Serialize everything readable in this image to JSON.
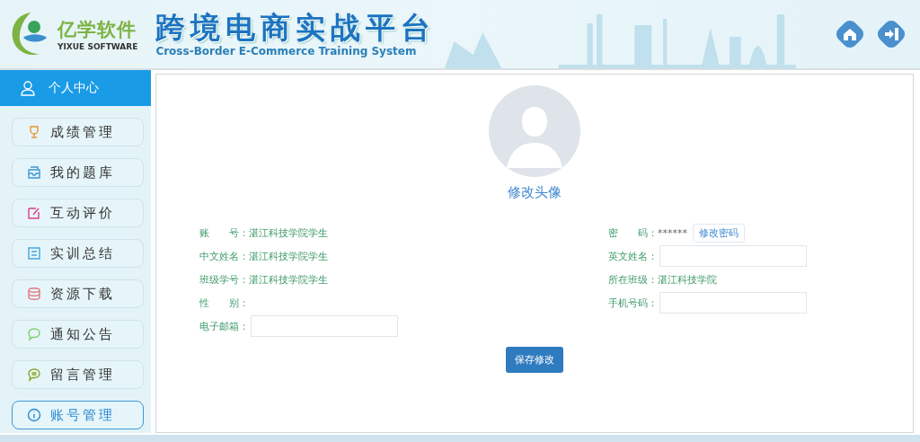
{
  "header": {
    "brand": "亿学软件",
    "brand_en": "YIXUE SOFTWARE",
    "title": "跨境电商实战平台",
    "subtitle": "Cross-Border E-Commerce Training System"
  },
  "sidebar": {
    "header": {
      "label": "个人中心",
      "selected": true
    },
    "items": [
      {
        "label": "成绩管理",
        "selected": false
      },
      {
        "label": "我的题库",
        "selected": false
      },
      {
        "label": "互动评价",
        "selected": false
      },
      {
        "label": "实训总结",
        "selected": false
      },
      {
        "label": "资源下载",
        "selected": false
      },
      {
        "label": "通知公告",
        "selected": false
      },
      {
        "label": "留言管理",
        "selected": false
      },
      {
        "label": "账号管理",
        "selected": true
      }
    ]
  },
  "profile": {
    "avatar_link": "修改头像",
    "left": [
      {
        "kind": "text",
        "label": "账　　号：",
        "value": "湛江科技学院学生"
      },
      {
        "kind": "text",
        "label": "中文姓名：",
        "value": "湛江科技学院学生"
      },
      {
        "kind": "text",
        "label": "班级学号：",
        "value": "湛江科技学院学生"
      },
      {
        "kind": "text",
        "label": "性　　别："
      },
      {
        "kind": "input",
        "label": "电子邮箱："
      }
    ],
    "right": [
      {
        "kind": "password",
        "label": "密　　码：",
        "value": "******",
        "button": "修改密码"
      },
      {
        "kind": "input",
        "label": "英文姓名："
      },
      {
        "kind": "text",
        "label": "所在班级：",
        "value": "湛江科技学院"
      },
      {
        "kind": "input",
        "label": "手机号码："
      }
    ],
    "save_button": "保存修改"
  }
}
